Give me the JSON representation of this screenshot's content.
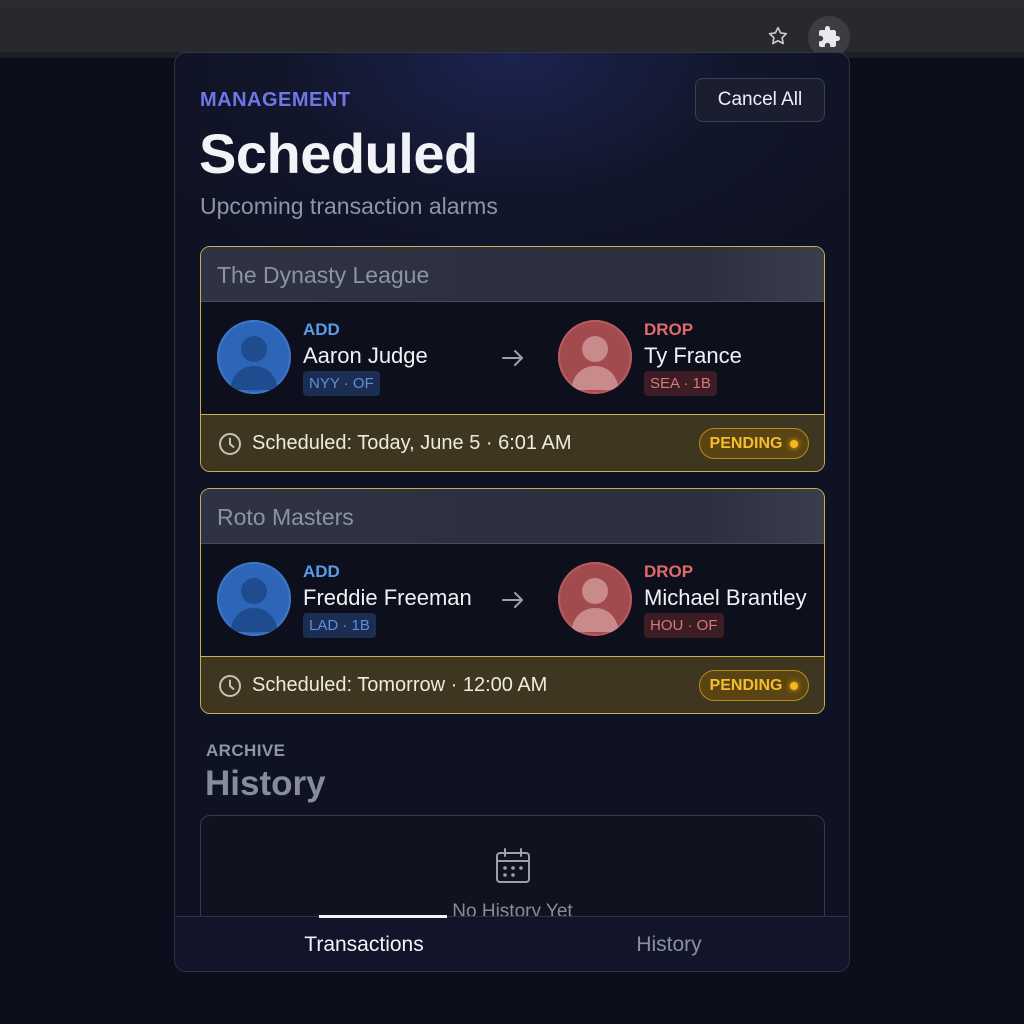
{
  "browser": {
    "star_icon": "star-icon",
    "extension_icon": "puzzle-icon"
  },
  "header": {
    "eyebrow": "MANAGEMENT",
    "title": "Scheduled",
    "subtitle": "Upcoming transaction alarms",
    "cancel_all_label": "Cancel All"
  },
  "transactions": [
    {
      "league": "The Dynasty League",
      "add": {
        "action": "ADD",
        "name": "Aaron Judge",
        "team": "NYY · OF"
      },
      "drop": {
        "action": "DROP",
        "name": "Ty France",
        "team": "SEA · 1B"
      },
      "schedule": "Scheduled: Today, June 5 · 6:01 AM",
      "status": "PENDING"
    },
    {
      "league": "Roto Masters",
      "add": {
        "action": "ADD",
        "name": "Freddie Freeman",
        "team": "LAD · 1B"
      },
      "drop": {
        "action": "DROP",
        "name": "Michael Brantley",
        "team": "HOU · OF"
      },
      "schedule": "Scheduled: Tomorrow · 12:00 AM",
      "status": "PENDING"
    }
  ],
  "archive": {
    "eyebrow": "ARCHIVE",
    "title": "History",
    "empty_text": "No History Yet"
  },
  "tabs": [
    {
      "label": "Transactions",
      "active": true
    },
    {
      "label": "History",
      "active": false
    }
  ],
  "colors": {
    "accent": "#6f76e8",
    "add": "#5a9be8",
    "drop": "#e06a6a",
    "pending": "#f5bd2c"
  }
}
